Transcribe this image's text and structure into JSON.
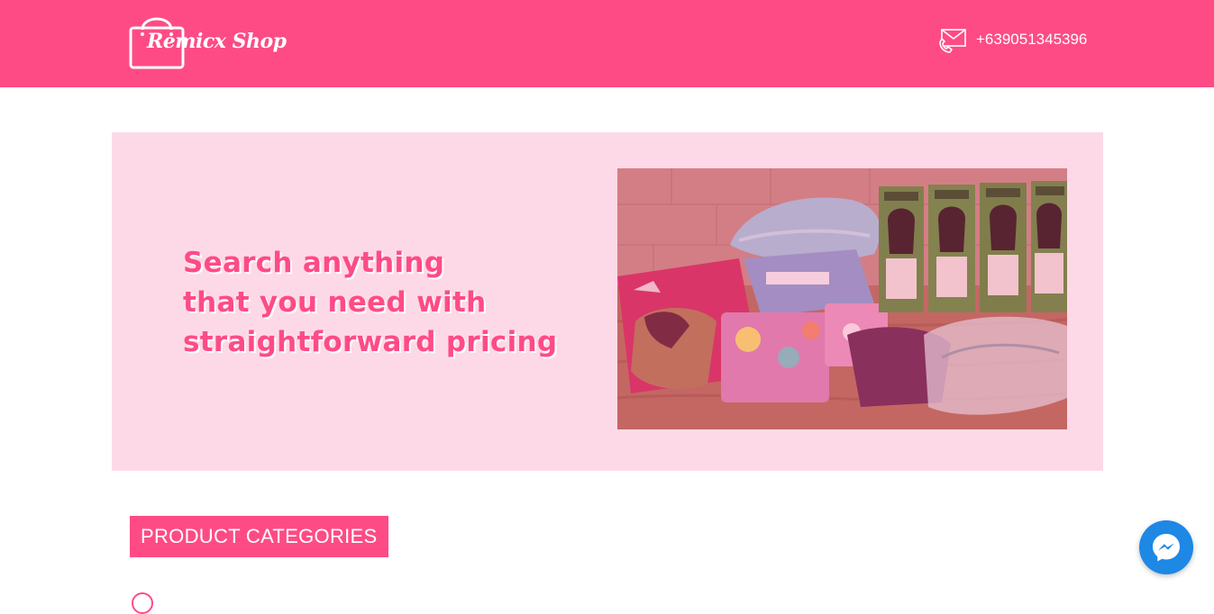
{
  "header": {
    "logo_text": "Remicx Shop",
    "phone_icon": "phone-envelope-icon",
    "phone_number": "+639051345396"
  },
  "hero": {
    "title_lines": [
      "Search anything",
      "that you need with",
      "straightforward pricing"
    ]
  },
  "categories": {
    "heading": "PRODUCT CATEGORIES"
  },
  "chat": {
    "icon": "messenger-icon"
  },
  "colors": {
    "brand_pink": "#fe4b86",
    "hero_bg": "#fdd9e7",
    "messenger_blue": "#1e88e5"
  }
}
